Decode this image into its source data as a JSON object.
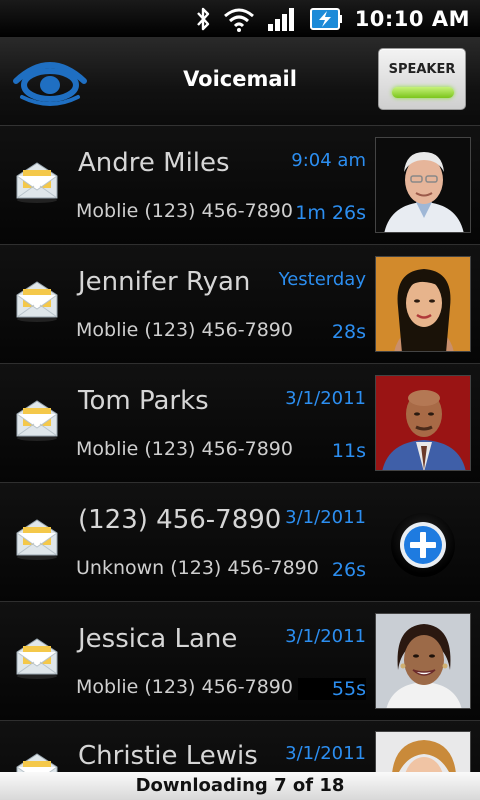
{
  "status_bar": {
    "time": "10:10 AM"
  },
  "header": {
    "title": "Voicemail",
    "speaker_label": "SPEAKER"
  },
  "voicemails": [
    {
      "name": "Andre Miles",
      "line": "Moblie (123) 456-7890",
      "date": "9:04 am",
      "duration": "1m 26s",
      "photo": "avatar-older-man"
    },
    {
      "name": "Jennifer Ryan",
      "line": "Moblie (123) 456-7890",
      "date": "Yesterday",
      "duration": "28s",
      "photo": "avatar-woman-asian"
    },
    {
      "name": "Tom Parks",
      "line": "Moblie (123) 456-7890",
      "date": "3/1/2011",
      "duration": "11s",
      "photo": "avatar-man-bald"
    },
    {
      "name": "(123) 456-7890",
      "line": "Unknown (123) 456-7890",
      "date": "3/1/2011",
      "duration": "26s",
      "photo": "add-contact-icon"
    },
    {
      "name": "Jessica Lane",
      "line": "Moblie (123) 456-7890",
      "date": "3/1/2011",
      "duration": "55s",
      "photo": "avatar-woman-smiling"
    },
    {
      "name": "Christie Lewis",
      "line": "",
      "date": "3/1/2011",
      "duration": "",
      "photo": "avatar-woman-blonde"
    }
  ],
  "footer": {
    "status": "Downloading 7 of 18"
  },
  "colors": {
    "accent_blue": "#2c8ef0",
    "speaker_led": "#7bc51c",
    "logo_blue": "#1f6fc2"
  }
}
